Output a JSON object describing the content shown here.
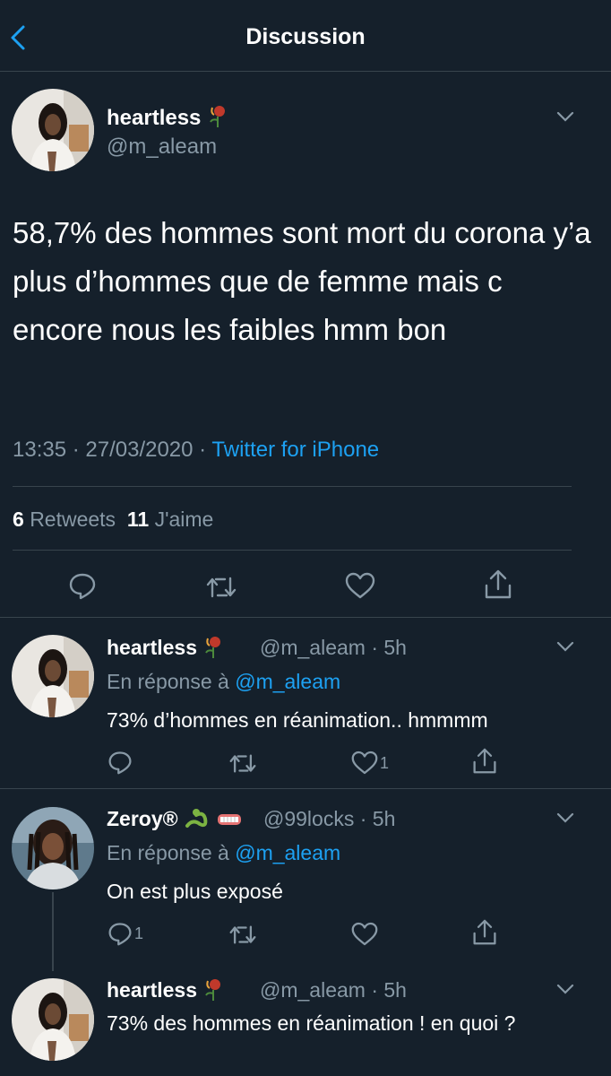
{
  "header": {
    "title": "Discussion"
  },
  "main_tweet": {
    "name": "heartless",
    "handle": "@m_aleam",
    "text": "58,7% des hommes sont mort du corona y’a plus d’hommes que de femme mais c encore nous les faibles hmm bon",
    "time": "13:35 · 27/03/2020 · ",
    "source": "Twitter for iPhone",
    "retweets_count": "6",
    "retweets_label": "Retweets",
    "likes_count": "11",
    "likes_label": "J'aime"
  },
  "replies": [
    {
      "name": "heartless",
      "handle": "@m_aleam · 5h",
      "reply_prefix": "En réponse à ",
      "reply_to": "@m_aleam",
      "text": "73% d’hommes en réanimation.. hmmmm",
      "reply_count": "",
      "like_count": "1"
    },
    {
      "name": "Zeroy®",
      "handle": "@99locks · 5h",
      "reply_prefix": "En réponse à ",
      "reply_to": "@m_aleam",
      "text": "On est plus exposé",
      "reply_count": "1",
      "like_count": ""
    },
    {
      "name": "heartless",
      "handle": "@m_aleam · 5h",
      "text": "73% des hommes en réanimation ! en quoi ?"
    }
  ],
  "colors": {
    "background": "#15202b",
    "accent": "#1da1f2",
    "muted": "#8899a6",
    "divider": "#38444d"
  },
  "icons": [
    "back-chevron-icon",
    "chevron-down-icon",
    "reply-icon",
    "retweet-icon",
    "like-icon",
    "share-icon",
    "rose-emoji-icon",
    "snake-emoji-icon",
    "grill-emoji-icon"
  ]
}
